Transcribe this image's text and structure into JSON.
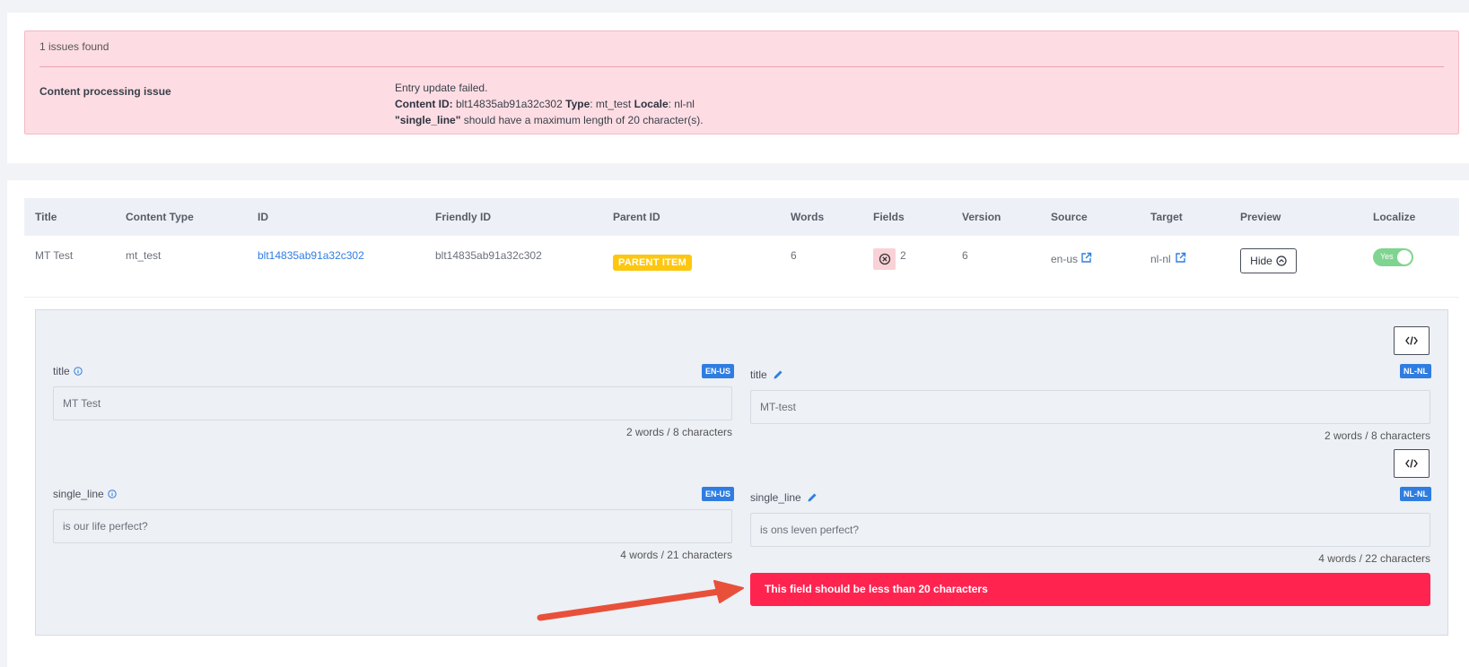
{
  "issues": {
    "count_text": "1 issues found",
    "kind": "Content processing issue",
    "line1": "Entry update failed.",
    "content_id_label": "Content ID:",
    "content_id": "blt14835ab91a32c302",
    "type_label": "Type",
    "type_value": ": mt_test",
    "locale_label": "Locale",
    "locale_value": ": nl-nl",
    "field_name": "\"single_line\"",
    "field_msg": "should have a maximum length of 20 character(s)."
  },
  "table": {
    "headers": {
      "title": "Title",
      "content_type": "Content Type",
      "id": "ID",
      "friendly_id": "Friendly ID",
      "parent_id": "Parent ID",
      "words": "Words",
      "fields": "Fields",
      "version": "Version",
      "source": "Source",
      "target": "Target",
      "preview": "Preview",
      "localize": "Localize"
    },
    "row": {
      "title": "MT Test",
      "content_type": "mt_test",
      "id": "blt14835ab91a32c302",
      "friendly_id": "blt14835ab91a32c302",
      "parent_badge": "PARENT ITEM",
      "words": "6",
      "fields_errors": "2",
      "version": "6",
      "source": "en-us",
      "target": "nl-nl",
      "preview_btn": "Hide",
      "localize_toggle": "Yes"
    }
  },
  "preview": {
    "fields": [
      {
        "name": "title",
        "source_locale": "EN-US",
        "target_locale": "NL-NL",
        "source_value": "MT Test",
        "target_value": "MT-test",
        "source_count": "2 words / 8 characters",
        "target_count": "2 words / 8 characters"
      },
      {
        "name": "single_line",
        "source_locale": "EN-US",
        "target_locale": "NL-NL",
        "source_value": "is our life perfect?",
        "target_value": "is ons leven perfect?",
        "source_count": "4 words / 21 characters",
        "target_count": "4 words / 22 characters"
      }
    ],
    "error_message": "This field should be less than 20 characters"
  },
  "colors": {
    "accent": "#2f7de1",
    "error": "#ff2450",
    "badge": "#fec70f",
    "toggle_on": "#7fd48f",
    "arrow": "#e8503a"
  }
}
